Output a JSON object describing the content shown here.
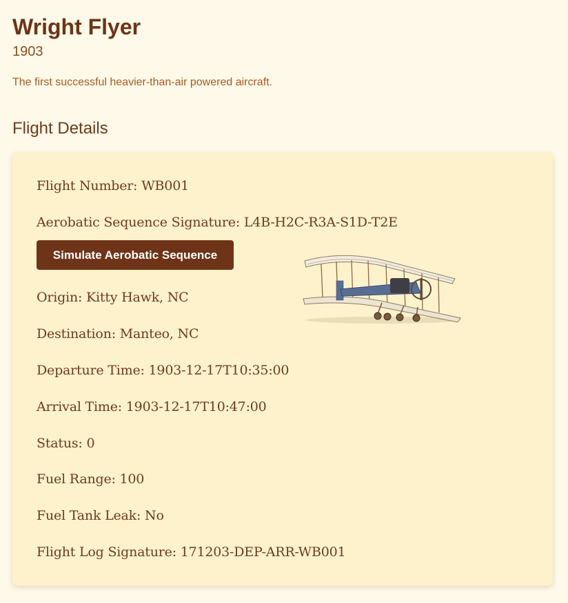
{
  "aircraft": {
    "name": "Wright Flyer",
    "year": "1903",
    "description": "The first successful heavier-than-air powered aircraft."
  },
  "section": {
    "title": "Flight Details"
  },
  "details": {
    "flight_number": "Flight Number: WB001",
    "aerobatic_signature": "Aerobatic Sequence Signature: L4B-H2C-R3A-S1D-T2E",
    "simulate_button": "Simulate Aerobatic Sequence",
    "origin": "Origin: Kitty Hawk, NC",
    "destination": "Destination: Manteo, NC",
    "departure": "Departure Time: 1903-12-17T10:35:00",
    "arrival": "Arrival Time: 1903-12-17T10:47:00",
    "status": "Status: 0",
    "fuel_range": "Fuel Range: 100",
    "fuel_leak": "Fuel Tank Leak: No",
    "log_signature": "Flight Log Signature: 171203-DEP-ARR-WB001"
  },
  "colors": {
    "background": "#fef9e8",
    "card": "#fdf2cc",
    "text": "#6e3a1c",
    "button": "#6e3418",
    "description": "#a65a22"
  },
  "images": {
    "plane": "biplane-illustration"
  }
}
